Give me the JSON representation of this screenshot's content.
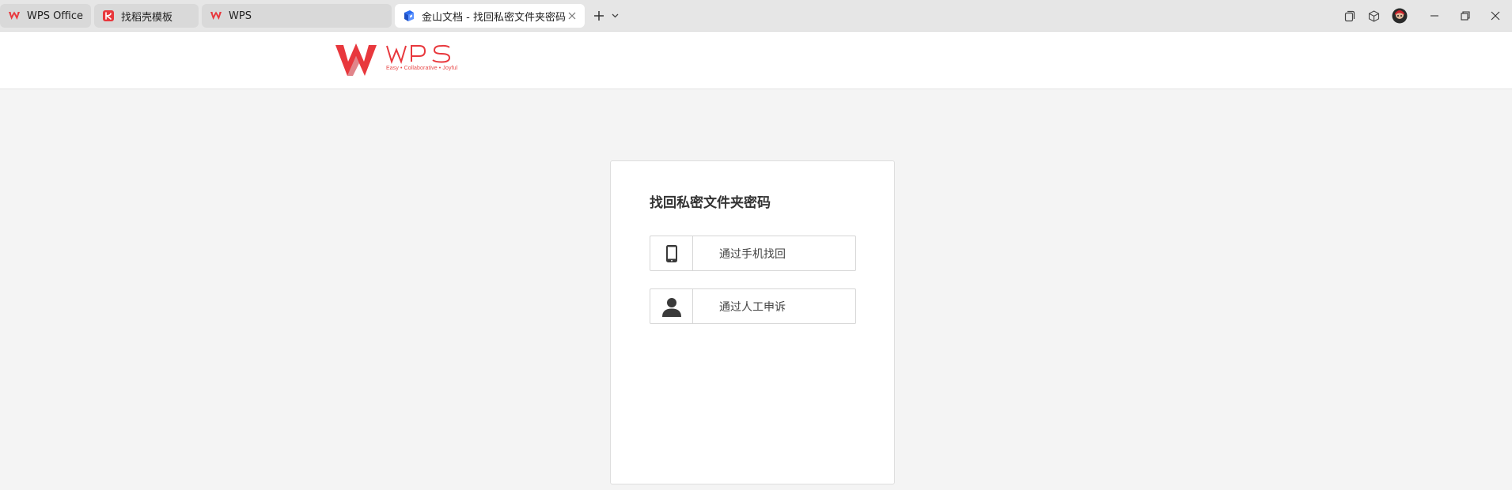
{
  "browser": {
    "tabs": [
      {
        "label": "WPS Office",
        "icon": "wps-icon"
      },
      {
        "label": "找稻壳模板",
        "icon": "docer-icon"
      },
      {
        "label": "WPS",
        "icon": "wps-icon"
      },
      {
        "label": "金山文档 - 找回私密文件夹密码",
        "icon": "kdocs-icon",
        "active": true
      }
    ],
    "new_tab_icon": "plus-icon",
    "tab_list_icon": "chevron-down-icon"
  },
  "header": {
    "logo_word": "WPS",
    "logo_tagline": "Easy • Collaborative • Joyful",
    "brand_color": "#e8383d"
  },
  "card": {
    "title": "找回私密文件夹密码",
    "options": [
      {
        "label": "通过手机找回",
        "icon": "phone-icon"
      },
      {
        "label": "通过人工申诉",
        "icon": "user-icon"
      }
    ]
  }
}
